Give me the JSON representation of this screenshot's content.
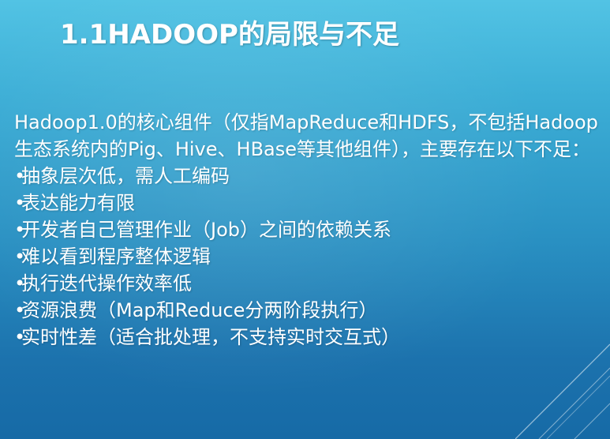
{
  "slide": {
    "title": "1.1HADOOP的局限与不足",
    "intro": "Hadoop1.0的核心组件（仅指MapReduce和HDFS，不包括Hadoop生态系统内的Pig、Hive、HBase等其他组件），主要存在以下不足：",
    "bullet_symbol": "•",
    "bullets": [
      "抽象层次低，需人工编码",
      "表达能力有限",
      "开发者自己管理作业（Job）之间的依赖关系",
      "难以看到程序整体逻辑",
      "执行迭代操作效率低",
      "资源浪费（Map和Reduce分两阶段执行）",
      "实时性差（适合批处理，不支持实时交互式）"
    ]
  },
  "colors": {
    "background_top": "#52c3e4",
    "background_bottom": "#166aa6",
    "text": "#ffffff"
  }
}
